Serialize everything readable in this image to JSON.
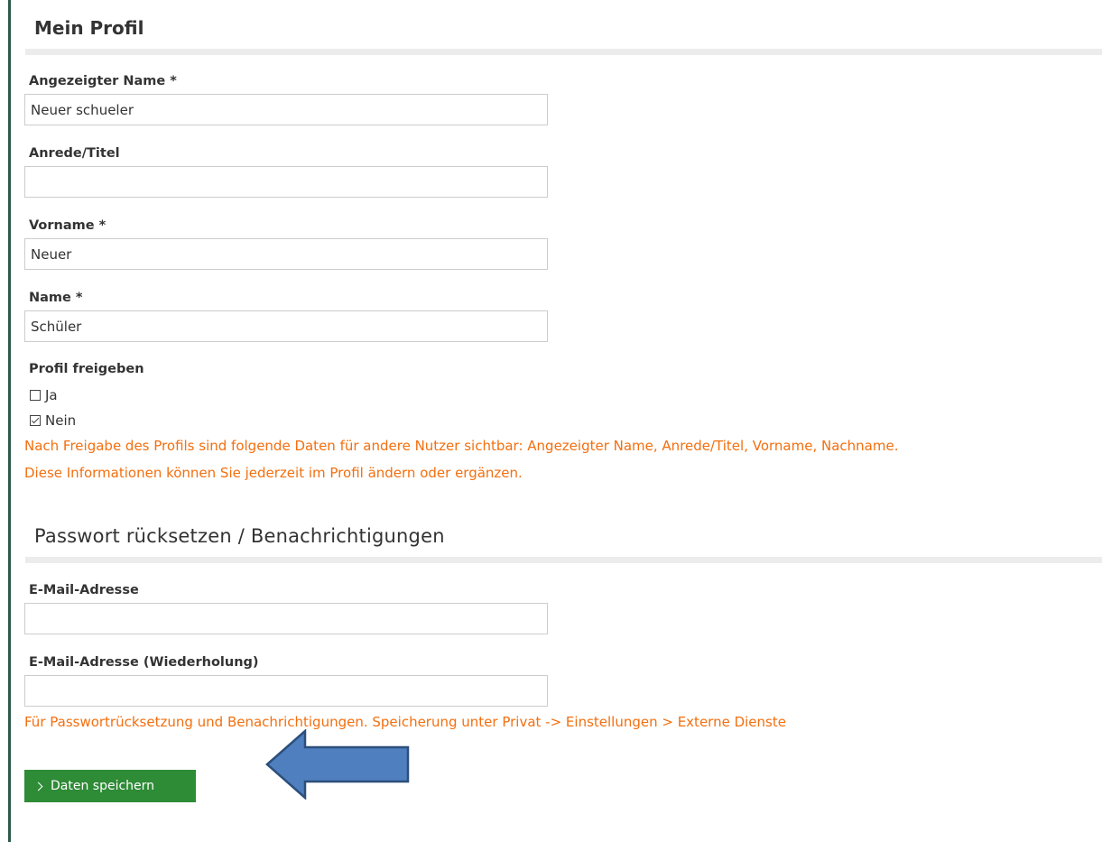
{
  "profile": {
    "title": "Mein Profil",
    "display_name": {
      "label": "Angezeigter Name *",
      "value": "Neuer schueler"
    },
    "salutation": {
      "label": "Anrede/Titel",
      "value": ""
    },
    "first_name": {
      "label": "Vorname *",
      "value": "Neuer"
    },
    "last_name": {
      "label": "Name *",
      "value": "Schüler"
    },
    "share": {
      "label": "Profil freigeben",
      "options": [
        {
          "label": "Ja",
          "checked": false
        },
        {
          "label": "Nein",
          "checked": true
        }
      ]
    },
    "share_hint_line1": "Nach Freigabe des Profils sind folgende Daten für andere Nutzer sichtbar: Angezeigter Name, Anrede/Titel, Vorname, Nachname.",
    "share_hint_line2": "Diese Informationen können Sie jederzeit im Profil ändern oder ergänzen."
  },
  "password": {
    "title": "Passwort rücksetzen / Benachrichtigungen",
    "email": {
      "label": "E-Mail-Adresse",
      "value": ""
    },
    "email_repeat": {
      "label": "E-Mail-Adresse (Wiederholung)",
      "value": ""
    },
    "hint": "Für Passwortrücksetzung und Benachrichtigungen. Speicherung unter Privat -> Einstellungen > Externe Dienste"
  },
  "actions": {
    "save_label": "Daten speichern"
  },
  "colors": {
    "accent_green": "#2e8b36",
    "hint_orange": "#f36f0f",
    "arrow_fill": "#4f7fbe",
    "arrow_stroke": "#2c4f7c"
  },
  "icons": {
    "save": "chevron-right-icon",
    "annotation": "arrow-left-icon"
  }
}
